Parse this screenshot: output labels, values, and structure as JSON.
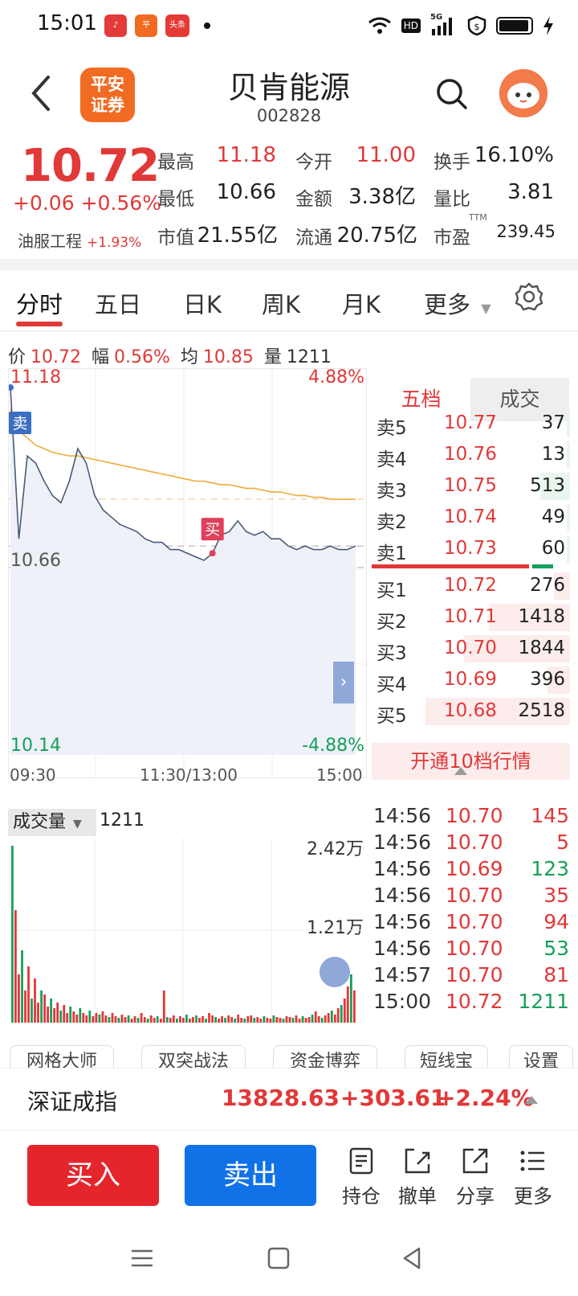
{
  "status": {
    "time": "15:01",
    "apps": [
      {
        "icon": "music-app-icon",
        "color": "#e33a3a"
      },
      {
        "icon": "pingan-app-icon",
        "color": "#f26b22"
      },
      {
        "icon": "toutiao-app-icon",
        "color": "#e53935",
        "label": "头条"
      }
    ],
    "indicators": {
      "network": "5G",
      "hd": "HD"
    }
  },
  "header": {
    "title": "贝肯能源",
    "code": "002828",
    "logo": [
      "平安",
      "证券"
    ]
  },
  "quote": {
    "price": "10.72",
    "change": "+0.06",
    "change_pct": "+0.56%",
    "sector": "油服工程",
    "sector_pct": "+1.93%",
    "fields": [
      {
        "label": "最高",
        "value": "11.18",
        "color": "red"
      },
      {
        "label": "今开",
        "value": "11.00",
        "color": "red"
      },
      {
        "label": "换手",
        "value": "16.10%",
        "color": "dark"
      },
      {
        "label": "最低",
        "value": "10.66",
        "color": "dark"
      },
      {
        "label": "金额",
        "value": "3.38亿",
        "color": "dark"
      },
      {
        "label": "量比",
        "value": "3.81",
        "color": "dark"
      },
      {
        "label": "市值",
        "value": "21.55亿",
        "color": "dark"
      },
      {
        "label": "流通",
        "value": "20.75亿",
        "color": "dark"
      },
      {
        "label": "市盈",
        "value": "239.45",
        "color": "dark",
        "sup": "TTM"
      }
    ]
  },
  "tabs": [
    "分时",
    "五日",
    "日K",
    "周K",
    "月K",
    "更多"
  ],
  "info": {
    "price_label": "价",
    "price": "10.72",
    "amp_label": "幅",
    "amp": "0.56%",
    "avg_label": "均",
    "avg": "10.85",
    "vol_label": "量",
    "vol": "1211"
  },
  "chart_data": {
    "type": "line",
    "title": "",
    "y_top": "11.18",
    "y_bottom": "10.14",
    "y_mid_label": "10.66",
    "pct_top": "4.88%",
    "pct_bottom": "-4.88%",
    "x_labels": [
      "09:30",
      "11:30/13:00",
      "15:00"
    ],
    "ylim": [
      10.14,
      11.18
    ],
    "series": [
      {
        "values": [
          11.16,
          10.74,
          10.97,
          10.95,
          10.9,
          10.86,
          10.84,
          10.9,
          10.99,
          10.95,
          10.86,
          10.82,
          10.8,
          10.78,
          10.77,
          10.76,
          10.74,
          10.73,
          10.73,
          10.71,
          10.71,
          10.7,
          10.69,
          10.68,
          10.7,
          10.75,
          10.76,
          10.79,
          10.76,
          10.75,
          10.76,
          10.74,
          10.74,
          10.72,
          10.71,
          10.72,
          10.71,
          10.71,
          10.72,
          10.71,
          10.71,
          10.72
        ]
      },
      {
        "values": [
          11.1,
          11.04,
          11.02,
          11.0,
          10.99,
          10.98,
          10.975,
          10.97,
          10.97,
          10.965,
          10.96,
          10.955,
          10.95,
          10.945,
          10.94,
          10.935,
          10.93,
          10.925,
          10.92,
          10.915,
          10.91,
          10.905,
          10.9,
          10.9,
          10.895,
          10.89,
          10.89,
          10.885,
          10.88,
          10.88,
          10.875,
          10.87,
          10.87,
          10.865,
          10.86,
          10.86,
          10.855,
          10.855,
          10.85,
          10.85,
          10.85,
          10.85
        ]
      }
    ],
    "markers": [
      {
        "label": "卖",
        "index": 0
      },
      {
        "label": "买",
        "index": 24
      }
    ],
    "colors": {
      "price": "#4a5a7a",
      "avg": "#f0a93a",
      "up": "#e13838",
      "down": "#16a05a"
    }
  },
  "orderbook": {
    "tabs": [
      "五档",
      "成交"
    ],
    "sells": [
      {
        "label": "卖5",
        "price": "10.77",
        "vol": "37"
      },
      {
        "label": "卖4",
        "price": "10.76",
        "vol": "13"
      },
      {
        "label": "卖3",
        "price": "10.75",
        "vol": "513"
      },
      {
        "label": "卖2",
        "price": "10.74",
        "vol": "49"
      },
      {
        "label": "卖1",
        "price": "10.73",
        "vol": "60"
      }
    ],
    "buys": [
      {
        "label": "买1",
        "price": "10.72",
        "vol": "276"
      },
      {
        "label": "买2",
        "price": "10.71",
        "vol": "1418"
      },
      {
        "label": "买3",
        "price": "10.70",
        "vol": "1844"
      },
      {
        "label": "买4",
        "price": "10.69",
        "vol": "396"
      },
      {
        "label": "买5",
        "price": "10.68",
        "vol": "2518"
      }
    ],
    "upgrade": "开通10档行情"
  },
  "volume": {
    "selector": "成交量",
    "value": "1211",
    "max_label": "2.42万",
    "mid_label": "1.21万"
  },
  "trades": [
    {
      "time": "14:56",
      "price": "10.70",
      "vol": "145",
      "dir": "red"
    },
    {
      "time": "14:56",
      "price": "10.70",
      "vol": "5",
      "dir": "red"
    },
    {
      "time": "14:56",
      "price": "10.69",
      "vol": "123",
      "dir": "green"
    },
    {
      "time": "14:56",
      "price": "10.70",
      "vol": "35",
      "dir": "red"
    },
    {
      "time": "14:56",
      "price": "10.70",
      "vol": "94",
      "dir": "red"
    },
    {
      "time": "14:56",
      "price": "10.70",
      "vol": "53",
      "dir": "green"
    },
    {
      "time": "14:57",
      "price": "10.70",
      "vol": "81",
      "dir": "red"
    },
    {
      "time": "15:00",
      "price": "10.72",
      "vol": "1211",
      "dir": "green"
    }
  ],
  "tools": [
    "网格大师",
    "双突战法",
    "资金博弈",
    "短线宝",
    "设置"
  ],
  "index": {
    "name": "深证成指",
    "value": "13828.63",
    "change": "+303.61",
    "pct": "+2.24%"
  },
  "actions": {
    "buy": "买入",
    "sell": "卖出",
    "items": [
      "持仓",
      "撤单",
      "分享",
      "更多"
    ]
  }
}
